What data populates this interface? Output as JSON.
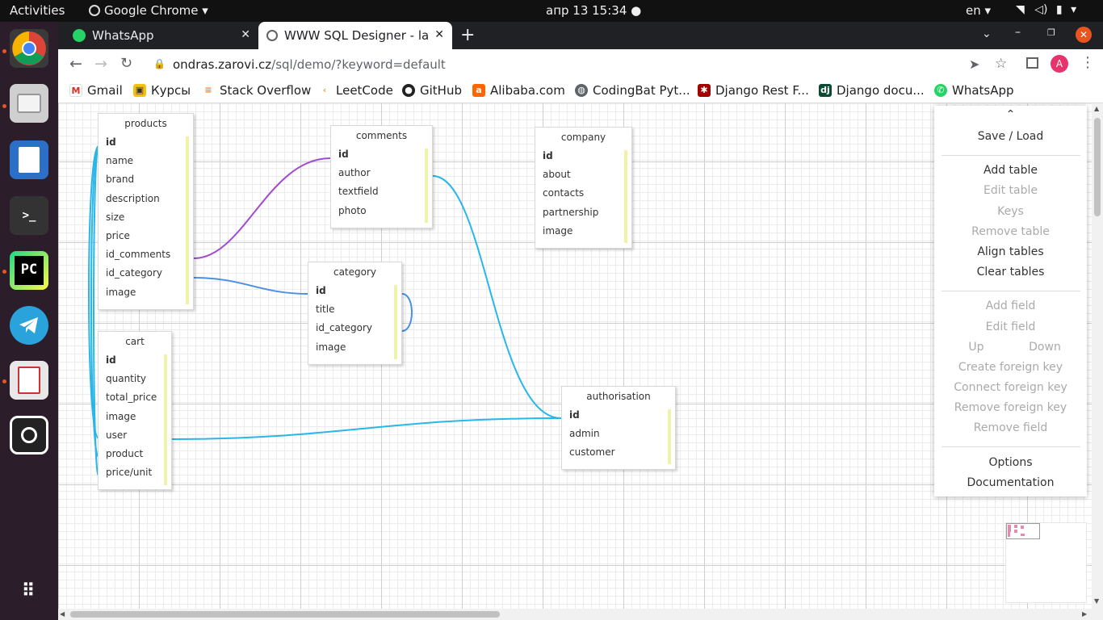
{
  "topbar": {
    "activities": "Activities",
    "app_name": "Google Chrome",
    "datetime": "апр 13  15:34",
    "lang": "en"
  },
  "dock": [
    "chrome-icon",
    "files-icon",
    "text-editor-icon",
    "terminal-icon",
    "pycharm-icon",
    "telegram-icon",
    "document-viewer-icon",
    "screenshot-icon",
    "app-grid-icon"
  ],
  "tabs": [
    {
      "label": "WhatsApp",
      "active": false
    },
    {
      "label": "WWW SQL Designer - last",
      "active": true
    }
  ],
  "omnibox": {
    "host": "ondras.zarovi.cz",
    "path": "/sql/demo/?keyword=default",
    "avatar": "A"
  },
  "bookmarks": [
    "Gmail",
    "Курсы",
    "Stack Overflow",
    "LeetCode",
    "GitHub",
    "Alibaba.com",
    "CodingBat Pyt...",
    "Django Rest F...",
    "Django docu...",
    "WhatsApp"
  ],
  "tables": [
    {
      "title": "products",
      "rows": [
        "id",
        "name",
        "brand",
        "description",
        "size",
        "price",
        "id_comments",
        "id_category",
        "image"
      ]
    },
    {
      "title": "comments",
      "rows": [
        "id",
        "author",
        "textfield",
        "photo"
      ]
    },
    {
      "title": "company",
      "rows": [
        "id",
        "about",
        "contacts",
        "partnership",
        "image"
      ]
    },
    {
      "title": "category",
      "rows": [
        "id",
        "title",
        "id_category",
        "image"
      ]
    },
    {
      "title": "cart",
      "rows": [
        "id",
        "quantity",
        "total_price",
        "image",
        "user",
        "product",
        "price/unit"
      ]
    },
    {
      "title": "authorisation",
      "rows": [
        "id",
        "admin",
        "customer"
      ]
    }
  ],
  "menu": {
    "collapse": "⌃",
    "save_load": "Save / Load",
    "add_table": "Add table",
    "edit_table": "Edit table",
    "keys": "Keys",
    "remove_table": "Remove table",
    "align_tables": "Align tables",
    "clear_tables": "Clear tables",
    "add_field": "Add field",
    "edit_field": "Edit field",
    "up": "Up",
    "down": "Down",
    "create_fk": "Create foreign key",
    "connect_fk": "Connect foreign key",
    "remove_fk": "Remove foreign key",
    "remove_field": "Remove field",
    "options": "Options",
    "documentation": "Documentation"
  },
  "colors": {
    "relation_purple": "#a04bd0",
    "relation_cyan": "#29b6e8",
    "relation_blue": "#4a90e2",
    "field_bar": "#eef3a8",
    "chrome_dark": "#202124",
    "dock": "#2b1e2a"
  }
}
